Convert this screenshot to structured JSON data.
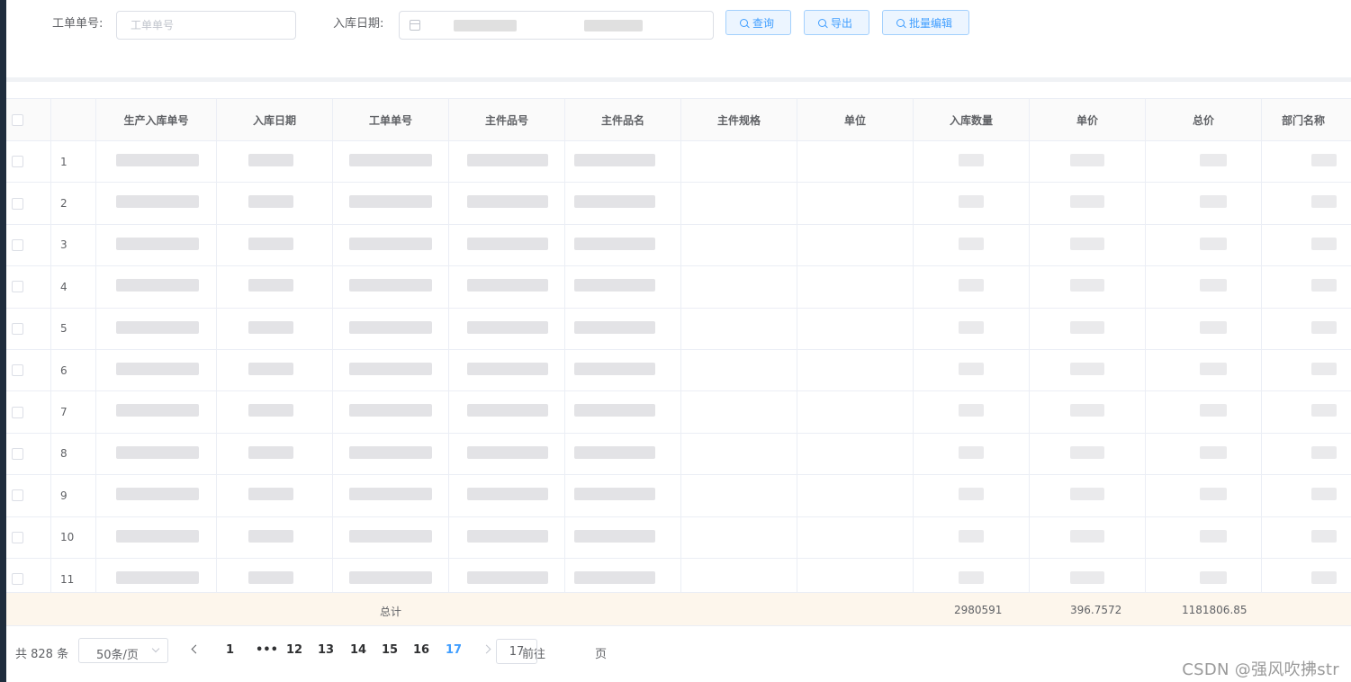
{
  "search": {
    "work_order_label": "工单单号:",
    "work_order_placeholder": "工单单号",
    "date_label": "入库日期:",
    "buttons": [
      {
        "label": "查询",
        "icon": "search-icon"
      },
      {
        "label": "导出",
        "icon": "search-icon"
      },
      {
        "label": "批量编辑",
        "icon": "search-icon"
      }
    ]
  },
  "table": {
    "columns": [
      "",
      "",
      "生产入库单号",
      "入库日期",
      "工单单号",
      "主件品号",
      "主件品名",
      "主件规格",
      "单位",
      "入库数量",
      "单价",
      "总价",
      "部门名称"
    ],
    "row_indices": [
      "1",
      "2",
      "3",
      "4",
      "5",
      "6",
      "7",
      "8",
      "9",
      "10",
      "11"
    ]
  },
  "summary": {
    "label": "总计",
    "quantity_total": "2980591",
    "unit_price_total": "396.7572",
    "price_total": "1181806.85"
  },
  "pagination": {
    "total": "共 828 条",
    "page_size": "50条/页",
    "pages": [
      "1",
      "•••",
      "12",
      "13",
      "14",
      "15",
      "16",
      "17"
    ],
    "current_page": "17",
    "goto_label": "前往",
    "goto_value": "17",
    "goto_suffix": "页"
  },
  "watermark": "CSDN @强风吹拂str",
  "colors": {
    "primary": "#409eff",
    "summary_bg": "#fdf6ec",
    "border": "#ebeef5"
  }
}
